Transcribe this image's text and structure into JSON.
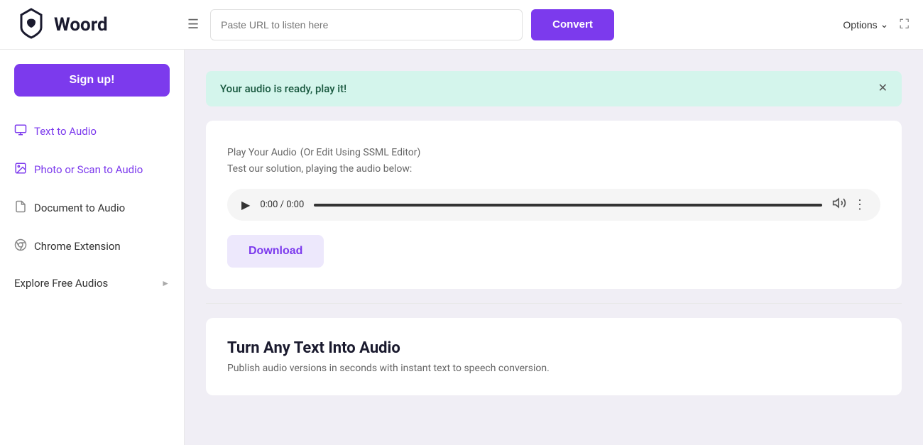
{
  "header": {
    "logo_text": "Woord",
    "url_placeholder": "Paste URL to listen here",
    "convert_label": "Convert",
    "options_label": "Options"
  },
  "sidebar": {
    "signup_label": "Sign up!",
    "nav_items": [
      {
        "id": "text-to-audio",
        "label": "Text to Audio",
        "active": true,
        "icon": "monitor-icon",
        "has_arrow": false
      },
      {
        "id": "photo-scan-to-audio",
        "label": "Photo or Scan to Audio",
        "active": true,
        "icon": "image-icon",
        "has_arrow": false
      },
      {
        "id": "document-to-audio",
        "label": "Document to Audio",
        "active": false,
        "icon": "file-icon",
        "has_arrow": false
      },
      {
        "id": "chrome-extension",
        "label": "Chrome Extension",
        "active": false,
        "icon": "chrome-icon",
        "has_arrow": false
      },
      {
        "id": "explore-free-audios",
        "label": "Explore Free Audios",
        "active": false,
        "icon": null,
        "has_arrow": true
      }
    ]
  },
  "main": {
    "notification": {
      "text": "Your audio is ready, play it!"
    },
    "audio_section": {
      "title": "Play Your Audio",
      "title_suffix": "(Or Edit Using SSML Editor)",
      "subtitle": "Test our solution, playing the audio below:",
      "time": "0:00 / 0:00",
      "download_label": "Download"
    },
    "promo_section": {
      "title": "Turn Any Text Into Audio",
      "subtitle": "Publish audio versions in seconds with instant text to speech conversion."
    }
  }
}
